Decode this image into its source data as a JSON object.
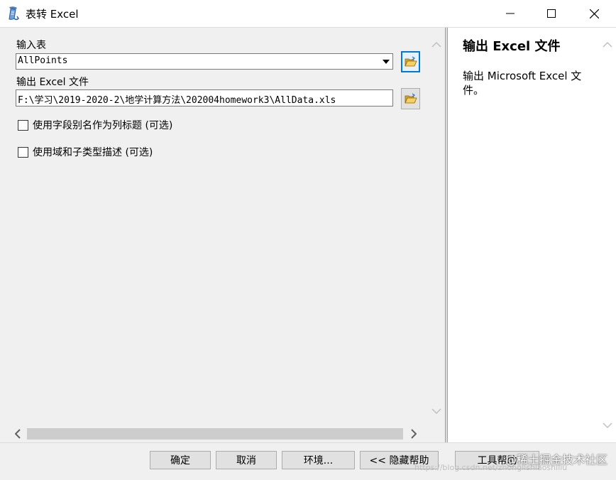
{
  "window": {
    "title": "表转 Excel",
    "icon": "arctoolbox-scroll-icon"
  },
  "form": {
    "input_table_label": "输入表",
    "input_table_value": "AllPoints",
    "output_file_label": "输出 Excel 文件",
    "output_file_value": "F:\\学习\\2019-2020-2\\地学计算方法\\202004homework3\\AllData.xls",
    "checkbox_alias_label": "使用字段别名作为列标题 (可选)",
    "checkbox_alias_checked": false,
    "checkbox_domain_label": "使用域和子类型描述 (可选)",
    "checkbox_domain_checked": false
  },
  "help": {
    "title": "输出 Excel 文件",
    "body": "输出 Microsoft Excel 文件。"
  },
  "buttons": {
    "ok": "确定",
    "cancel": "取消",
    "environments": "环境...",
    "hide_help": "<< 隐藏帮助",
    "tool_help": "工具帮助"
  },
  "watermark": {
    "text": "@稀土掘金技术社区",
    "url": "https://blog.csdn.net/zhonglishiaoshiliu"
  },
  "colors": {
    "accent": "#0078d7",
    "pane_bg": "#f0f0f0",
    "help_bg": "#ffffff"
  }
}
